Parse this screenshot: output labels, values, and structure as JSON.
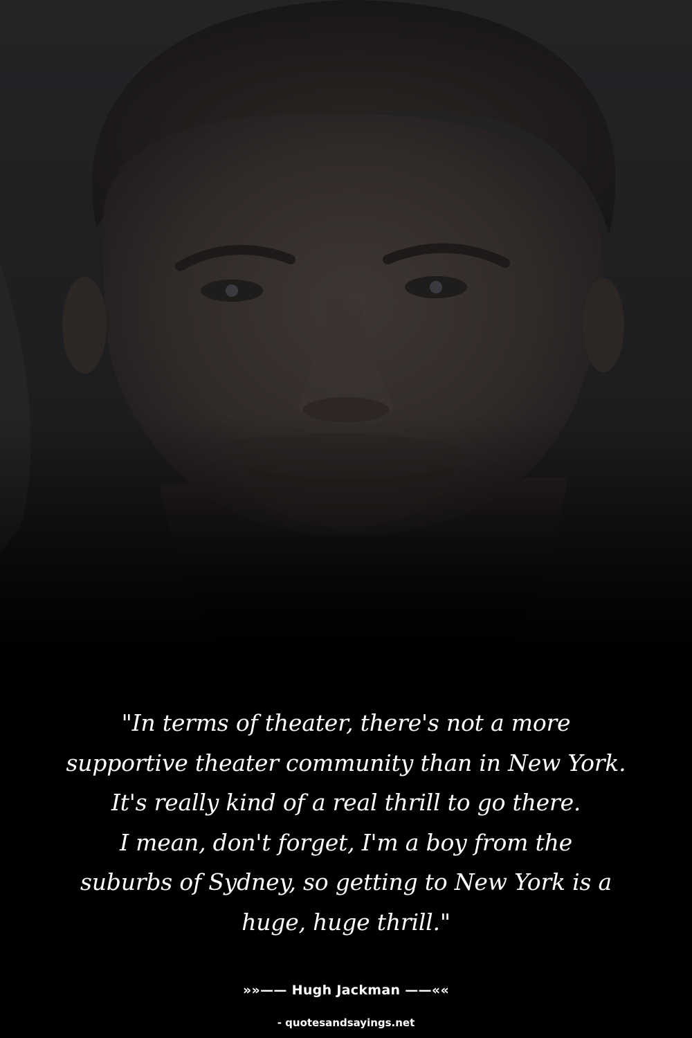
{
  "quote": {
    "lines": [
      "\"In terms of theater, there's not a more",
      "supportive theater community than in New York.",
      "It's really kind of a real thrill to go there.",
      "I mean, don't forget, I'm a boy from the",
      "suburbs of Sydney, so getting to New York is a",
      "huge, huge thrill.\""
    ]
  },
  "author": "»»—— Hugh Jackman ——««",
  "source": "- quotesandsayings.net",
  "colors": {
    "background": "#000000",
    "text": "#ffffff"
  }
}
